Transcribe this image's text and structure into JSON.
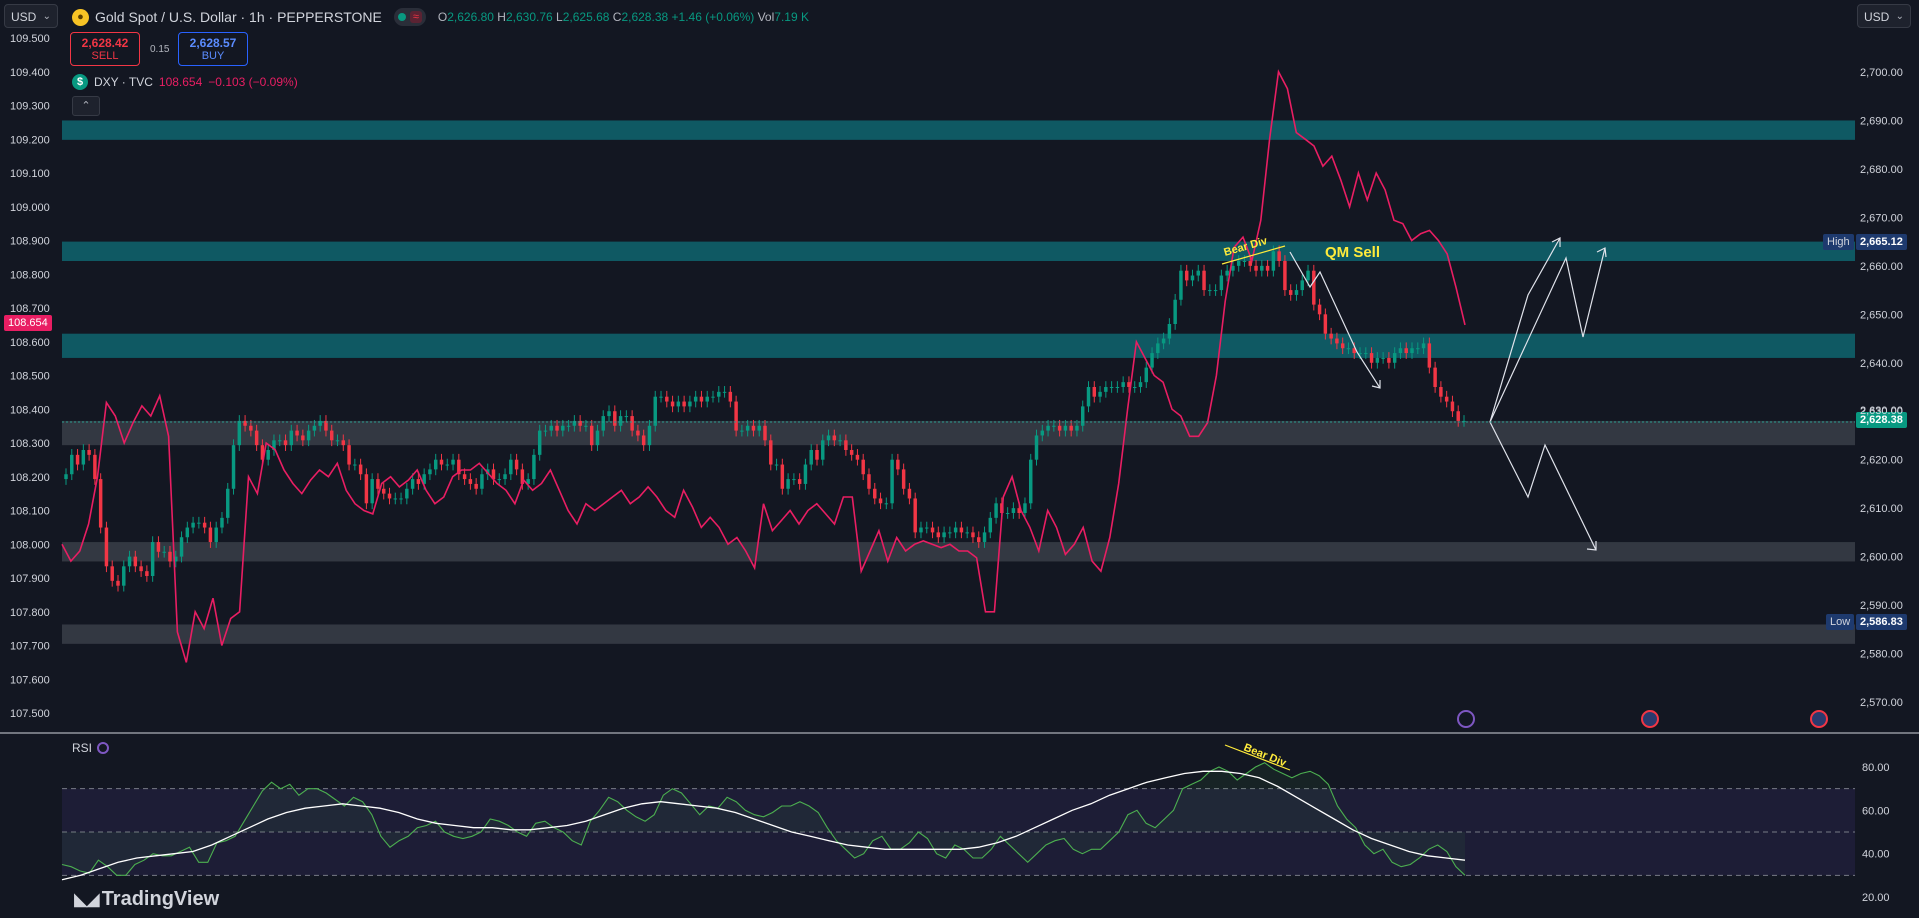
{
  "toolbar": {
    "currency_left": "USD",
    "currency_right": "USD"
  },
  "symbol": {
    "title": "Gold Spot / U.S. Dollar · 1h · PEPPERSTONE",
    "open_label": "O",
    "open": "2,626.80",
    "high_label": "H",
    "high": "2,630.76",
    "low_label": "L",
    "low": "2,625.68",
    "close_label": "C",
    "close": "2,628.38",
    "change": "+1.46 (+0.06%)",
    "vol_label": "Vol",
    "vol": "7.19 K"
  },
  "trade": {
    "sell_price": "2,628.42",
    "sell_label": "SELL",
    "spread": "0.15",
    "buy_price": "2,628.57",
    "buy_label": "BUY"
  },
  "overlay": {
    "name": "DXY · TVC",
    "value": "108.654",
    "change": "−0.103 (−0.09%)"
  },
  "annotations": {
    "bear_div_top": "Bear Div",
    "qm_sell": "QM Sell",
    "bear_div_rsi": "Bear Div"
  },
  "price_tags": {
    "high_label": "High",
    "high_value": "2,665.12",
    "low_label": "Low",
    "low_value": "2,586.83",
    "last_value": "2,628.38",
    "partial_value": "2,630.00",
    "dxy_current": "108.654"
  },
  "rsi": {
    "label": "RSI",
    "axis": [
      "80.00",
      "60.00",
      "40.00",
      "20.00"
    ]
  },
  "brand": {
    "name": "TradingView"
  },
  "colors": {
    "background": "#131722",
    "bull": "#089981",
    "bear": "#f23645",
    "dxy_line": "#e91e63",
    "zone_teal": "#0f5d67",
    "zone_gray": "#3a3e48",
    "rsi": "#4caf50",
    "annotation": "#ffeb3b"
  },
  "chart_data": [
    {
      "type": "candlestick",
      "title": "Gold Spot / U.S. Dollar · 1h · PEPPERSTONE",
      "ylim": [
        2565,
        2705
      ],
      "yticks": [
        "2,700.00",
        "2,690.00",
        "2,680.00",
        "2,670.00",
        "2,660.00",
        "2,650.00",
        "2,640.00",
        "2,630.00",
        "2,620.00",
        "2,610.00",
        "2,600.00",
        "2,590.00",
        "2,580.00",
        "2,570.00"
      ],
      "zones": [
        {
          "from": 2686,
          "to": 2690,
          "color": "teal"
        },
        {
          "from": 2661,
          "to": 2665,
          "color": "teal"
        },
        {
          "from": 2641,
          "to": 2646,
          "color": "teal"
        },
        {
          "from": 2623,
          "to": 2628,
          "color": "gray"
        },
        {
          "from": 2599,
          "to": 2603,
          "color": "gray"
        },
        {
          "from": 2582,
          "to": 2586,
          "color": "gray"
        }
      ],
      "closes": [
        2617,
        2621,
        2619,
        2622,
        2621,
        2616,
        2606,
        2598,
        2595,
        2594,
        2598,
        2600,
        2598,
        2597,
        2596,
        2603,
        2601,
        2601,
        2599,
        2600,
        2604,
        2606,
        2607,
        2607,
        2606,
        2603,
        2606,
        2608,
        2614,
        2623,
        2628,
        2627,
        2626,
        2623,
        2620,
        2622,
        2624,
        2624,
        2623,
        2626,
        2625,
        2624,
        2626,
        2627,
        2628,
        2626,
        2624,
        2624,
        2623,
        2619,
        2619,
        2617,
        2611,
        2616,
        2614,
        2613,
        2612,
        2612,
        2612,
        2614,
        2616,
        2615,
        2617,
        2618,
        2620,
        2619,
        2619,
        2620,
        2617,
        2616,
        2615,
        2614,
        2617,
        2618,
        2616,
        2616,
        2617,
        2620,
        2618,
        2615,
        2616,
        2621,
        2626,
        2626,
        2627,
        2626,
        2627,
        2627,
        2628,
        2627,
        2627,
        2623,
        2626,
        2629,
        2630,
        2627,
        2629,
        2629,
        2626,
        2625,
        2623,
        2627,
        2633,
        2633,
        2632,
        2631,
        2632,
        2631,
        2632,
        2633,
        2632,
        2633,
        2633,
        2634,
        2634,
        2632,
        2626,
        2626,
        2627,
        2626,
        2627,
        2624,
        2619,
        2619,
        2614,
        2616,
        2616,
        2615,
        2619,
        2622,
        2620,
        2624,
        2625,
        2624,
        2624,
        2622,
        2621,
        2620,
        2617,
        2614,
        2612,
        2611,
        2611,
        2620,
        2618,
        2614,
        2612,
        2605,
        2606,
        2606,
        2605,
        2604,
        2605,
        2605,
        2606,
        2605,
        2605,
        2604,
        2603,
        2605,
        2608,
        2611,
        2609,
        2609,
        2610,
        2609,
        2611,
        2620,
        2625,
        2626,
        2627,
        2627,
        2626,
        2627,
        2626,
        2627,
        2631,
        2635,
        2633,
        2634,
        2635,
        2635,
        2635,
        2636,
        2635,
        2635,
        2636,
        2639,
        2642,
        2644,
        2645,
        2648,
        2653,
        2659,
        2657,
        2658,
        2659,
        2655,
        2655,
        2655,
        2658,
        2659,
        2660,
        2661,
        2661,
        2660,
        2659,
        2660,
        2659,
        2663,
        2661,
        2655,
        2654,
        2655,
        2657,
        2659,
        2652,
        2650,
        2646,
        2645,
        2644,
        2643,
        2643,
        2642,
        2642,
        2642,
        2640,
        2641,
        2641,
        2640,
        2642,
        2643,
        2642,
        2643,
        2643,
        2644,
        2639,
        2635,
        2633,
        2632,
        2630,
        2628,
        2628
      ]
    },
    {
      "type": "line",
      "name": "DXY · TVC",
      "ylim": [
        107.45,
        109.51
      ],
      "yticks": [
        "109.500",
        "109.400",
        "109.300",
        "109.200",
        "109.100",
        "109.000",
        "108.900",
        "108.800",
        "108.700",
        "108.600",
        "108.500",
        "108.400",
        "108.300",
        "108.200",
        "108.100",
        "108.000",
        "107.900",
        "107.800",
        "107.700",
        "107.600",
        "107.500"
      ],
      "values": [
        108.0,
        107.95,
        107.98,
        108.06,
        108.2,
        108.42,
        108.38,
        108.3,
        108.36,
        108.41,
        108.38,
        108.44,
        108.32,
        107.74,
        107.65,
        107.8,
        107.75,
        107.84,
        107.7,
        107.78,
        107.8,
        108.2,
        108.15,
        108.3,
        108.28,
        108.22,
        108.18,
        108.15,
        108.19,
        108.22,
        108.2,
        108.24,
        108.16,
        108.12,
        108.1,
        108.09,
        108.18,
        108.2,
        108.17,
        108.19,
        108.22,
        108.16,
        108.12,
        108.14,
        108.2,
        108.22,
        108.22,
        108.24,
        108.21,
        108.18,
        108.16,
        108.12,
        108.19,
        108.16,
        108.18,
        108.22,
        108.16,
        108.1,
        108.06,
        108.12,
        108.1,
        108.12,
        108.14,
        108.16,
        108.12,
        108.14,
        108.17,
        108.14,
        108.1,
        108.08,
        108.16,
        108.11,
        108.05,
        108.08,
        108.05,
        108.0,
        108.02,
        107.98,
        107.93,
        108.12,
        108.04,
        108.07,
        108.1,
        108.06,
        108.1,
        108.12,
        108.09,
        108.06,
        108.14,
        108.14,
        107.92,
        107.98,
        108.04,
        107.95,
        108.02,
        107.98,
        108.0,
        108.01,
        108.0,
        107.99,
        108.0,
        107.98,
        107.98,
        107.96,
        107.8,
        107.8,
        108.14,
        108.2,
        108.1,
        108.05,
        107.98,
        108.1,
        108.05,
        107.97,
        108.0,
        108.05,
        107.95,
        107.92,
        108.02,
        108.18,
        108.4,
        108.6,
        108.55,
        108.5,
        108.48,
        108.4,
        108.38,
        108.32,
        108.32,
        108.36,
        108.5,
        108.72,
        108.88,
        108.91,
        108.84,
        108.96,
        109.2,
        109.4,
        109.35,
        109.22,
        109.2,
        109.18,
        109.12,
        109.15,
        109.08,
        109.0,
        109.1,
        109.02,
        109.1,
        109.05,
        108.96,
        108.95,
        108.9,
        108.92,
        108.93,
        108.9,
        108.86,
        108.76,
        108.65
      ]
    },
    {
      "type": "line",
      "name": "RSI",
      "ylim": [
        20,
        85
      ],
      "yticks": [
        "80.00",
        "60.00",
        "40.00",
        "20.00"
      ],
      "bands": {
        "upper": 70,
        "middle": 50,
        "lower": 30
      },
      "values": [
        35,
        34,
        32,
        31,
        37,
        34,
        30,
        30,
        35,
        37,
        40,
        39,
        39,
        41,
        43,
        36,
        36,
        45,
        46,
        48,
        55,
        62,
        69,
        73,
        70,
        72,
        67,
        70,
        70,
        68,
        65,
        62,
        66,
        64,
        58,
        48,
        43,
        46,
        48,
        52,
        53,
        55,
        50,
        48,
        47,
        48,
        50,
        56,
        55,
        53,
        50,
        48,
        54,
        55,
        52,
        50,
        46,
        44,
        55,
        60,
        66,
        64,
        60,
        57,
        55,
        58,
        67,
        70,
        68,
        63,
        58,
        62,
        61,
        66,
        64,
        60,
        58,
        57,
        59,
        62,
        62,
        64,
        62,
        59,
        52,
        46,
        42,
        38,
        40,
        46,
        48,
        42,
        42,
        45,
        50,
        47,
        40,
        38,
        44,
        42,
        38,
        38,
        42,
        48,
        44,
        40,
        36,
        40,
        44,
        46,
        47,
        42,
        40,
        42,
        42,
        46,
        50,
        58,
        60,
        54,
        52,
        56,
        60,
        70,
        72,
        74,
        78,
        80,
        78,
        74,
        77,
        80,
        82,
        79,
        77,
        75,
        77,
        78,
        76,
        72,
        62,
        56,
        52,
        44,
        40,
        42,
        36,
        34,
        35,
        38,
        42,
        44,
        41,
        34,
        30
      ],
      "signal": [
        28,
        30,
        33,
        36,
        38,
        39,
        40,
        41,
        44,
        48,
        52,
        56,
        59,
        61,
        62,
        63,
        62,
        61,
        59,
        56,
        54,
        53,
        52,
        52,
        51,
        51,
        52,
        53,
        55,
        58,
        61,
        63,
        64,
        63,
        62,
        61,
        59,
        56,
        53,
        50,
        48,
        46,
        44,
        43,
        42,
        42,
        42,
        42,
        42,
        43,
        45,
        48,
        52,
        56,
        60,
        63,
        67,
        70,
        73,
        75,
        77,
        78,
        78,
        77,
        75,
        71,
        66,
        61,
        56,
        51,
        47,
        44,
        41,
        39,
        38,
        37
      ]
    }
  ]
}
